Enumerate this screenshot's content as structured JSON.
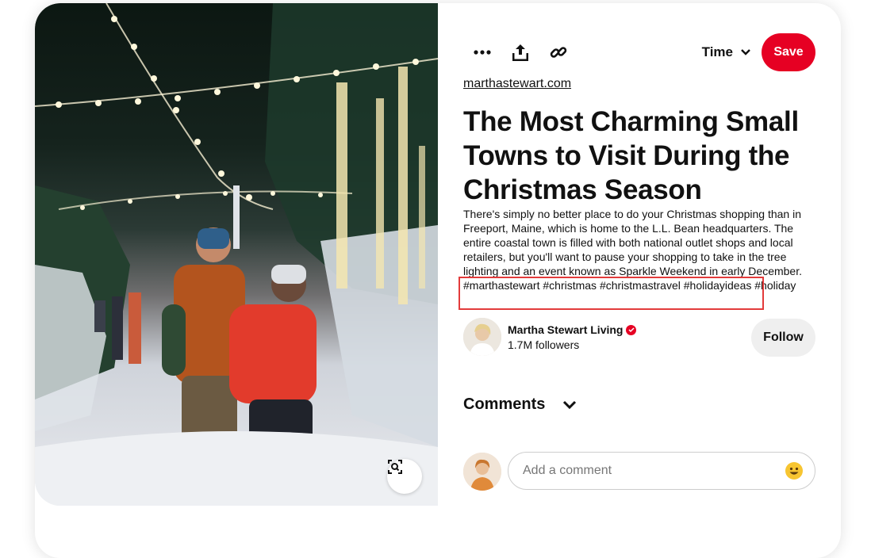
{
  "toolbar": {
    "more_icon": "more-icon",
    "share_icon": "share-icon",
    "link_icon": "link-icon",
    "board_label": "Time",
    "save_label": "Save"
  },
  "pin": {
    "source": "marthastewart.com",
    "title": "The Most Charming Small Towns to Visit During the Christmas Season",
    "description": "There's simply no better place to do your Christmas shopping than in Freeport, Maine, which is home to the L.L. Bean headquarters. The entire coastal town is filled with both national outlet shops and local retailers, but you'll want to pause your shopping to take in the tree lighting and an event known as Sparkle Weekend in early December. #marthastewart #christmas #christmastravel #holidayideas #holiday"
  },
  "creator": {
    "name": "Martha Stewart Living",
    "followers": "1.7M followers",
    "follow_label": "Follow"
  },
  "comments": {
    "heading": "Comments",
    "placeholder": "Add a comment"
  },
  "colors": {
    "accent": "#e60023",
    "highlight_box": "#e33b3b"
  }
}
